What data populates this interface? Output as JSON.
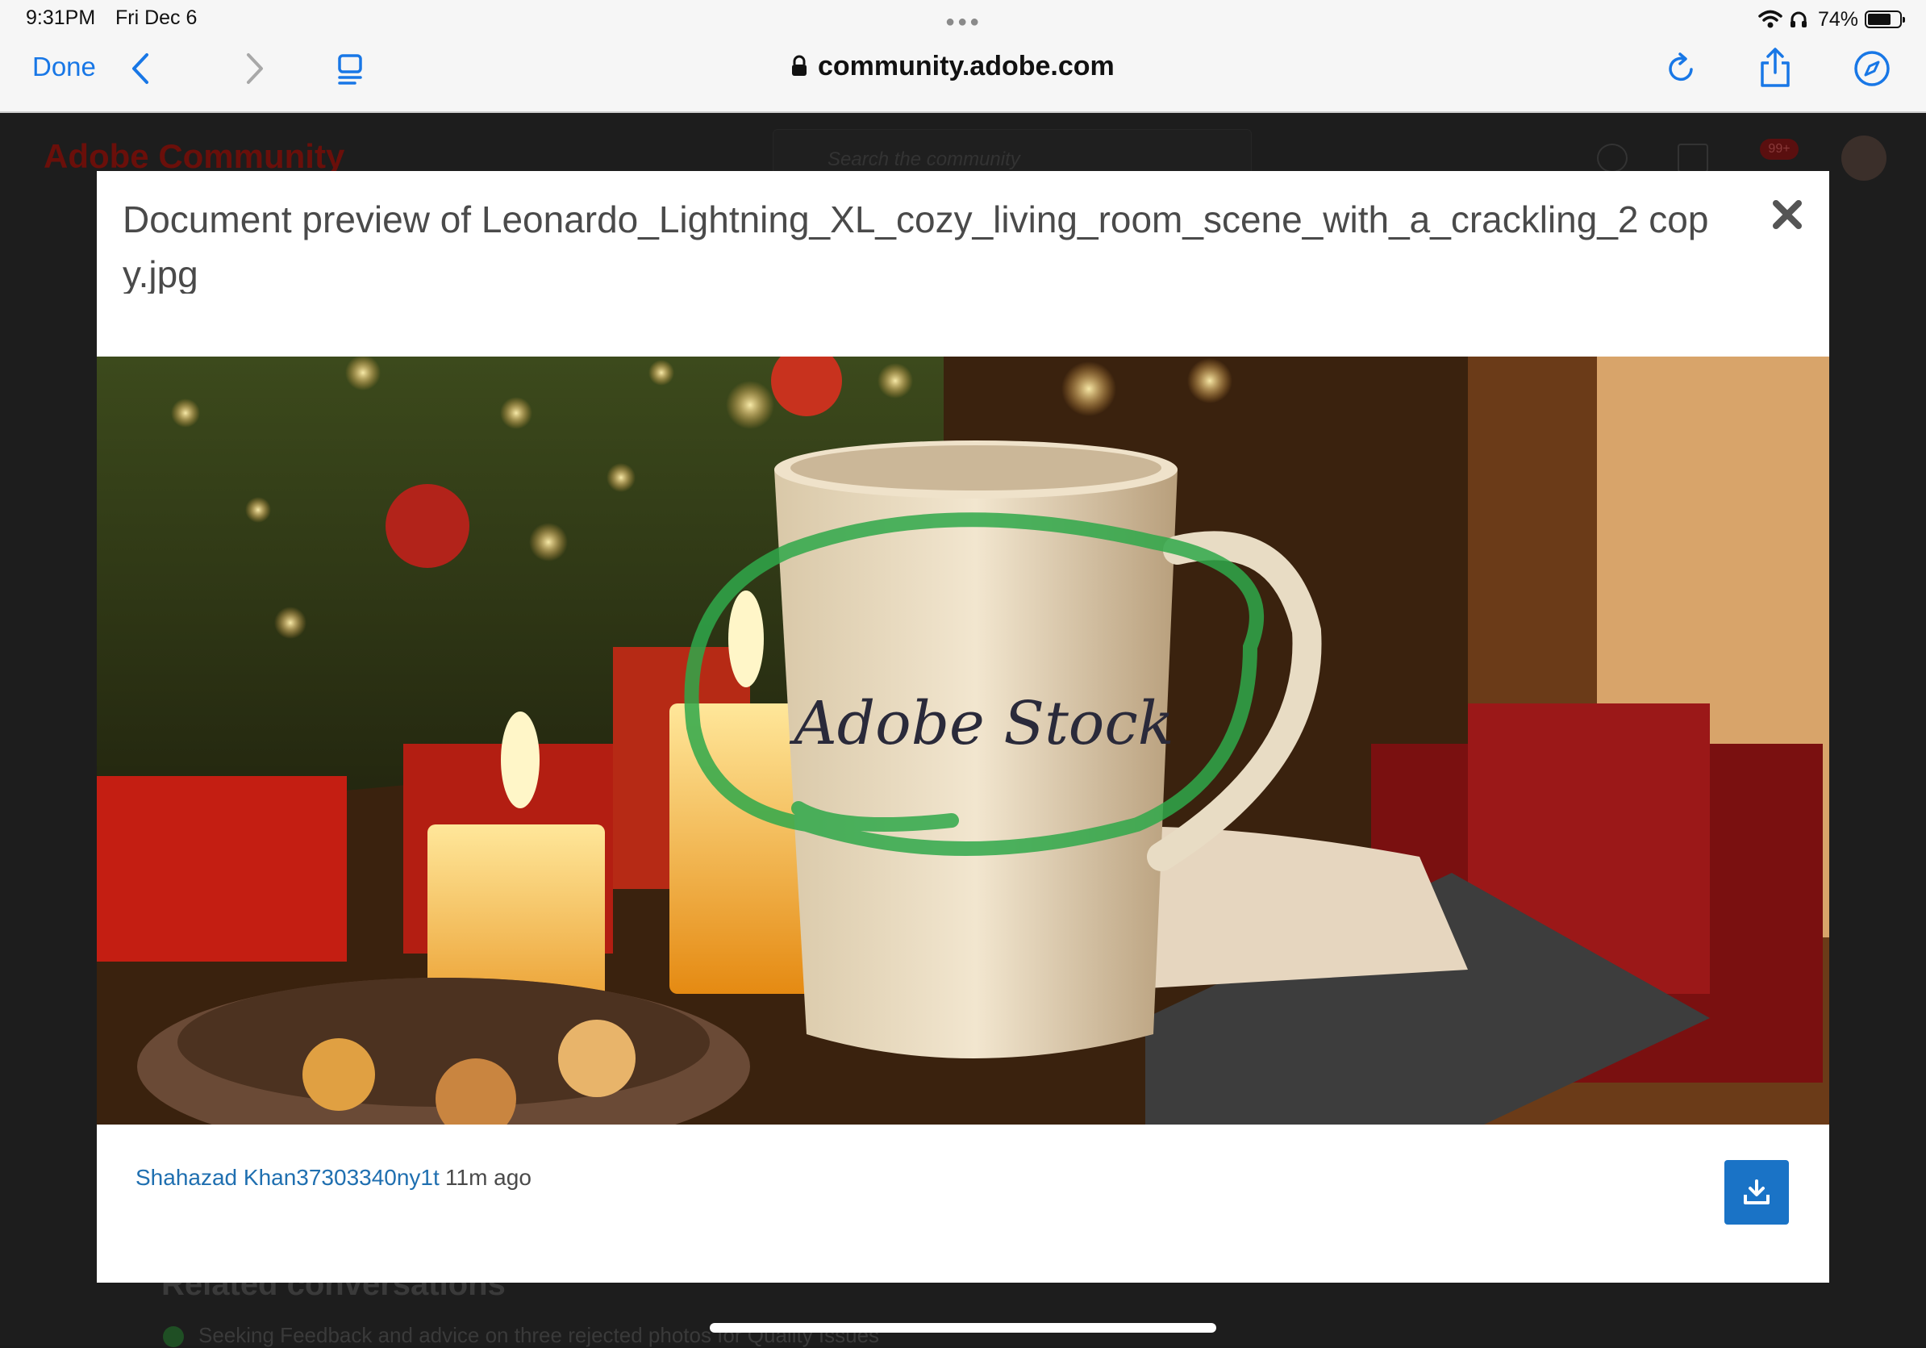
{
  "status_bar": {
    "time": "9:31PM",
    "date": "Fri Dec 6",
    "battery": "74%",
    "battery_level": 0.74
  },
  "browser": {
    "done_label": "Done",
    "url": "community.adobe.com",
    "icons": [
      "back-icon",
      "forward-icon",
      "reader-icon",
      "lock-icon",
      "reload-icon",
      "share-icon",
      "compass-icon"
    ]
  },
  "background_page": {
    "logo": "Adobe Community",
    "search_placeholder": "Search the community",
    "notification_badge": "99+",
    "related_heading": "Related conversations",
    "related_item": "Seeking Feedback and advice on three rejected photos for Quality Issues"
  },
  "modal": {
    "title": "Document preview of Leonardo_Lightning_XL_cozy_living_room_scene_with_a_crackling_2 copy.jpg",
    "author": "Shahazad Khan37303340ny1t",
    "time_ago": "11m ago",
    "image_text": "Adobe Stock"
  },
  "colors": {
    "link": "#1f6fb0",
    "download_button": "#1a73c6",
    "ios_blue": "#1877e6",
    "annotation_green": "#2fa84a"
  }
}
